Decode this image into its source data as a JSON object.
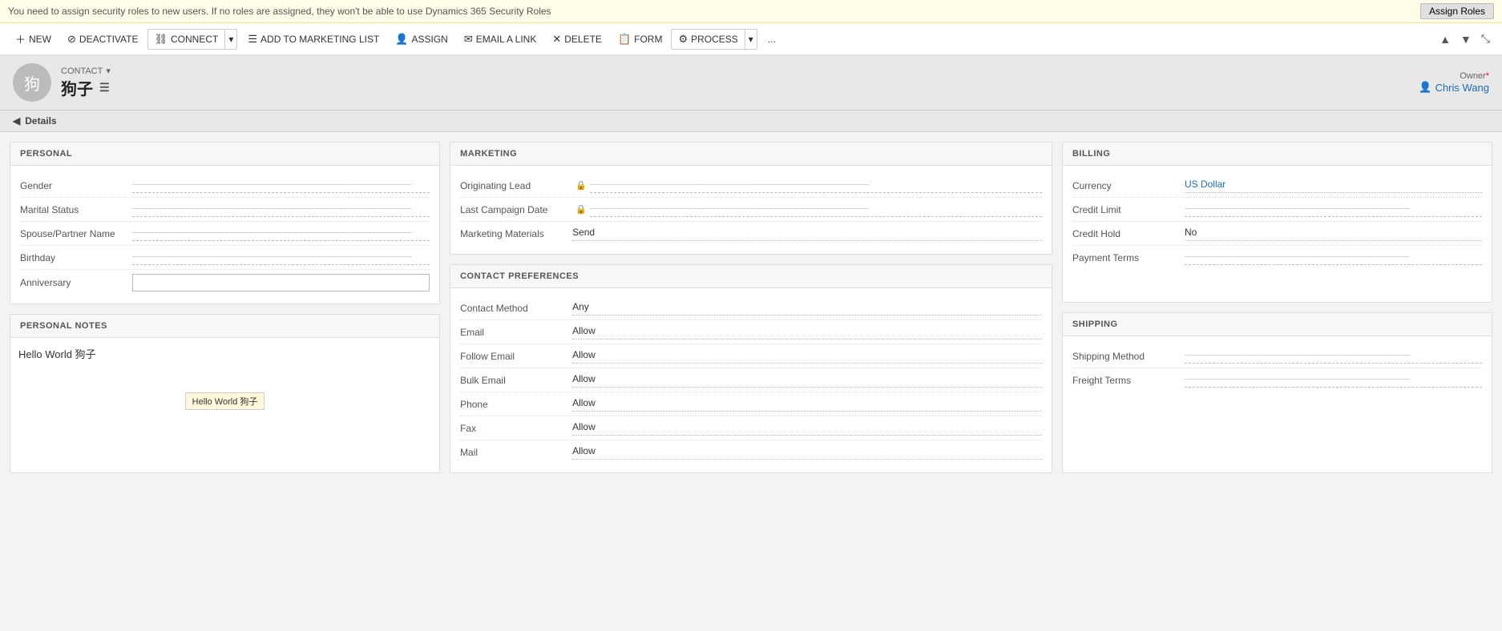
{
  "notification": {
    "text": "You need to assign security roles to new users. If no roles are assigned, they won't be able to use Dynamics 365 Security Roles",
    "button_label": "Assign Roles"
  },
  "toolbar": {
    "new_label": "NEW",
    "deactivate_label": "DEACTIVATE",
    "connect_label": "CONNECT",
    "add_to_marketing_label": "ADD TO MARKETING LIST",
    "assign_label": "ASSIGN",
    "email_link_label": "EMAIL A LINK",
    "delete_label": "DELETE",
    "form_label": "FORM",
    "process_label": "PROCESS",
    "more_label": "..."
  },
  "contact": {
    "type": "CONTACT",
    "name": "狗子",
    "avatar_letter": "狗"
  },
  "owner": {
    "label": "Owner",
    "required": true,
    "name": "Chris Wang"
  },
  "details_label": "Details",
  "personal": {
    "header": "PERSONAL",
    "fields": [
      {
        "label": "Gender",
        "value": ""
      },
      {
        "label": "Marital Status",
        "value": ""
      },
      {
        "label": "Spouse/Partner Name",
        "value": ""
      },
      {
        "label": "Birthday",
        "value": ""
      },
      {
        "label": "Anniversary",
        "value": "",
        "input": true
      }
    ]
  },
  "personal_notes": {
    "header": "PERSONAL NOTES",
    "text": "Hello World 狗子",
    "tooltip": "Hello World 狗子"
  },
  "marketing": {
    "header": "MARKETING",
    "fields": [
      {
        "label": "Originating Lead",
        "value": "",
        "locked": true
      },
      {
        "label": "Last Campaign Date",
        "value": "",
        "locked": true
      },
      {
        "label": "Marketing Materials",
        "value": "Send"
      }
    ]
  },
  "contact_preferences": {
    "header": "CONTACT PREFERENCES",
    "fields": [
      {
        "label": "Contact Method",
        "value": "Any"
      },
      {
        "label": "Email",
        "value": "Allow"
      },
      {
        "label": "Follow Email",
        "value": "Allow"
      },
      {
        "label": "Bulk Email",
        "value": "Allow"
      },
      {
        "label": "Phone",
        "value": "Allow"
      },
      {
        "label": "Fax",
        "value": "Allow"
      },
      {
        "label": "Mail",
        "value": "Allow"
      }
    ]
  },
  "billing": {
    "header": "BILLING",
    "fields": [
      {
        "label": "Currency",
        "value": "US Dollar",
        "link": true
      },
      {
        "label": "Credit Limit",
        "value": ""
      },
      {
        "label": "Credit Hold",
        "value": "No"
      },
      {
        "label": "Payment Terms",
        "value": ""
      }
    ]
  },
  "shipping": {
    "header": "SHIPPING",
    "fields": [
      {
        "label": "Shipping Method",
        "value": ""
      },
      {
        "label": "Freight Terms",
        "value": ""
      }
    ]
  }
}
